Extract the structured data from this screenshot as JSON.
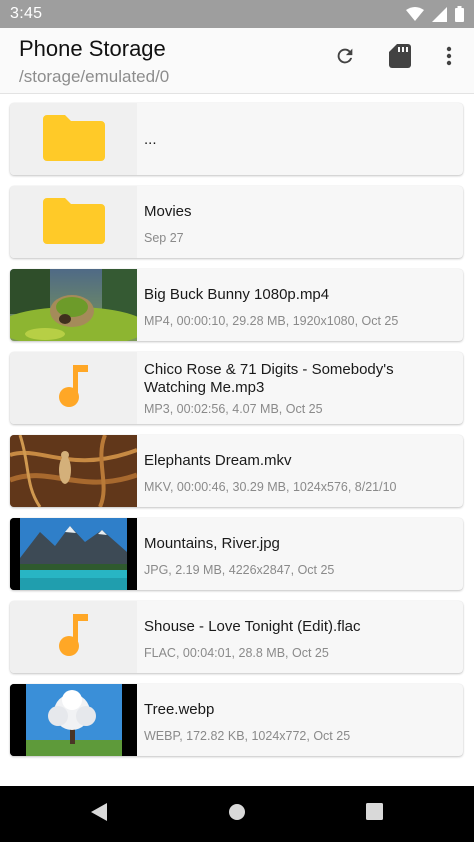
{
  "status_bar": {
    "time": "3:45",
    "icons": [
      "wifi-icon",
      "cell-signal-icon",
      "battery-icon"
    ]
  },
  "app_bar": {
    "title": "Phone Storage",
    "path": "/storage/emulated/0",
    "actions": [
      "refresh-icon",
      "sd-card-icon",
      "more-vert-icon"
    ]
  },
  "files": [
    {
      "name": "...",
      "meta": "",
      "thumb": "folder-icon"
    },
    {
      "name": "Movies",
      "meta": "Sep 27",
      "thumb": "folder-icon"
    },
    {
      "name": "Big Buck Bunny 1080p.mp4",
      "meta": "MP4, 00:00:10, 29.28 MB, 1920x1080, Oct 25",
      "thumb": "video-thumbnail"
    },
    {
      "name": "Chico Rose & 71 Digits - Somebody's Watching Me.mp3",
      "meta": "MP3, 00:02:56, 4.07 MB, Oct 25",
      "thumb": "music-note-icon"
    },
    {
      "name": "Elephants Dream.mkv",
      "meta": "MKV, 00:00:46, 30.29 MB, 1024x576, 8/21/10",
      "thumb": "video-thumbnail"
    },
    {
      "name": "Mountains, River.jpg",
      "meta": "JPG, 2.19 MB, 4226x2847, Oct 25",
      "thumb": "image-thumbnail"
    },
    {
      "name": "Shouse - Love Tonight (Edit).flac",
      "meta": "FLAC, 00:04:01, 28.8 MB, Oct 25",
      "thumb": "music-note-icon"
    },
    {
      "name": "Tree.webp",
      "meta": "WEBP, 172.82 KB, 1024x772, Oct 25",
      "thumb": "image-thumbnail"
    }
  ],
  "colors": {
    "folder": "#FFCA28",
    "music_note": "#FFA726",
    "status_bar": "#9e9e9e",
    "nav_bar": "#000000"
  },
  "nav_bar": {
    "buttons": [
      "back-icon",
      "home-icon",
      "recents-icon"
    ]
  }
}
